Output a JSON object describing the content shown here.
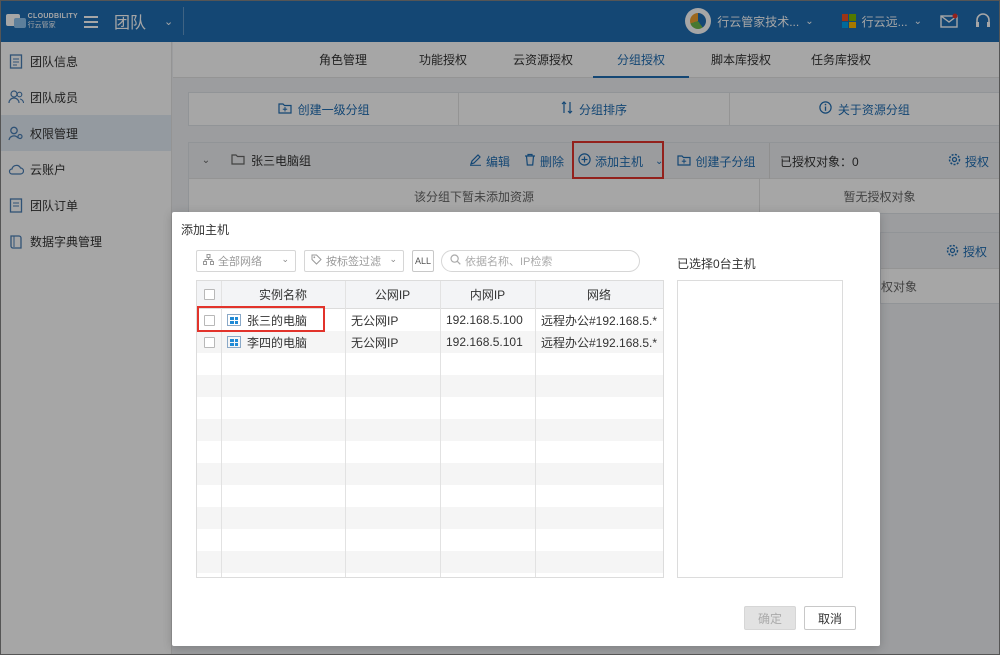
{
  "header": {
    "brand_en": "CLOUDBILITY",
    "brand_cn": "行云管家",
    "section_title": "团队",
    "org_name": "行云管家技术...",
    "account_name": "行云远...",
    "colors": {
      "topbar": "#1f6db3"
    }
  },
  "sidebar": {
    "items": [
      {
        "label": "团队信息",
        "icon": "document-icon"
      },
      {
        "label": "团队成员",
        "icon": "users-icon"
      },
      {
        "label": "权限管理",
        "icon": "user-key-icon"
      },
      {
        "label": "云账户",
        "icon": "cloud-icon"
      },
      {
        "label": "团队订单",
        "icon": "order-icon"
      },
      {
        "label": "数据字典管理",
        "icon": "book-icon"
      }
    ],
    "active_index": 2
  },
  "tabs": [
    {
      "label": "角色管理"
    },
    {
      "label": "功能授权"
    },
    {
      "label": "云资源授权"
    },
    {
      "label": "分组授权"
    },
    {
      "label": "脚本库授权"
    },
    {
      "label": "任务库授权"
    }
  ],
  "active_tab": 3,
  "actions": {
    "create_group": "创建一级分组",
    "sort_group": "分组排序",
    "about_group": "关于资源分组"
  },
  "group": {
    "name": "张三电脑组",
    "edit": "编辑",
    "delete": "删除",
    "add_host": "添加主机",
    "create_sub": "创建子分组",
    "authorized_label": "已授权对象：0",
    "authorize": "授权",
    "empty_resources": "该分组下暂未添加资源",
    "empty_authorized": "暂无授权对象"
  },
  "bg_panel2": {
    "authorize": "授权",
    "empty_partial": "权对象"
  },
  "modal": {
    "title": "添加主机",
    "network_filter": "全部网络",
    "tag_filter": "按标签过滤",
    "all_label": "ALL",
    "search_placeholder": "依据名称、IP检索",
    "selected_title": "已选择0台主机",
    "columns": [
      "实例名称",
      "公网IP",
      "内网IP",
      "网络"
    ],
    "rows": [
      {
        "name": "张三的电脑",
        "public_ip": "无公网IP",
        "private_ip": "192.168.5.100",
        "network": "远程办公#192.168.5.*"
      },
      {
        "name": "李四的电脑",
        "public_ip": "无公网IP",
        "private_ip": "192.168.5.101",
        "network": "远程办公#192.168.5.*"
      }
    ],
    "ok": "确定",
    "cancel": "取消"
  }
}
